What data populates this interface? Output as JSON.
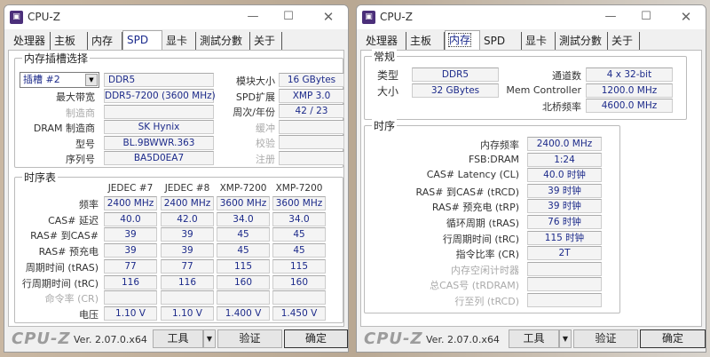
{
  "left": {
    "title": "CPU-Z",
    "tabs": [
      "处理器",
      "主板",
      "内存",
      "SPD",
      "显卡",
      "測試分數",
      "关于"
    ],
    "slot_group": "内存插槽选择",
    "slot_select": "插槽 #2",
    "type_value": "DDR5",
    "left_fields": [
      {
        "label": "最大带宽",
        "value": "DDR5-7200 (3600 MHz)",
        "dim": false
      },
      {
        "label": "制造商",
        "value": "",
        "dim": true
      },
      {
        "label": "DRAM 制造商",
        "value": "SK Hynix",
        "dim": false
      },
      {
        "label": "型号",
        "value": "BL.9BWWR.363",
        "dim": false
      },
      {
        "label": "序列号",
        "value": "BA5D0EA7",
        "dim": false
      }
    ],
    "right_fields": [
      {
        "label": "模块大小",
        "value": "16 GBytes",
        "dim": false
      },
      {
        "label": "SPD扩展",
        "value": "XMP 3.0",
        "dim": false
      },
      {
        "label": "周次/年份",
        "value": "42 / 23",
        "dim": false
      },
      {
        "label": "缓冲",
        "value": "",
        "dim": true
      },
      {
        "label": "校验",
        "value": "",
        "dim": true
      },
      {
        "label": "注册",
        "value": "",
        "dim": true
      }
    ],
    "timing_group": "时序表",
    "timing_columns": [
      "JEDEC #7",
      "JEDEC #8",
      "XMP-7200",
      "XMP-7200"
    ],
    "timing_rows": [
      {
        "label": "频率",
        "values": [
          "2400 MHz",
          "2400 MHz",
          "3600 MHz",
          "3600 MHz"
        ],
        "dim": false
      },
      {
        "label": "CAS# 延迟",
        "values": [
          "40.0",
          "42.0",
          "34.0",
          "34.0"
        ],
        "dim": false
      },
      {
        "label": "RAS# 到CAS#",
        "values": [
          "39",
          "39",
          "45",
          "45"
        ],
        "dim": false
      },
      {
        "label": "RAS# 预充电",
        "values": [
          "39",
          "39",
          "45",
          "45"
        ],
        "dim": false
      },
      {
        "label": "周期时间 (tRAS)",
        "values": [
          "77",
          "77",
          "115",
          "115"
        ],
        "dim": false
      },
      {
        "label": "行周期时间 (tRC)",
        "values": [
          "116",
          "116",
          "160",
          "160"
        ],
        "dim": false
      },
      {
        "label": "命令率 (CR)",
        "values": [
          "",
          "",
          "",
          ""
        ],
        "dim": true
      },
      {
        "label": "电压",
        "values": [
          "1.10 V",
          "1.10 V",
          "1.400 V",
          "1.450 V"
        ],
        "dim": false
      }
    ],
    "footer": {
      "logo": "CPU-Z",
      "version": "Ver. 2.07.0.x64",
      "tools": "工具",
      "validate": "验证",
      "ok": "确定"
    }
  },
  "right": {
    "title": "CPU-Z",
    "tabs": [
      "处理器",
      "主板",
      "内存",
      "SPD",
      "显卡",
      "測試分數",
      "关于"
    ],
    "general_group": "常规",
    "general_left": [
      {
        "label": "类型",
        "value": "DDR5"
      },
      {
        "label": "大小",
        "value": "32 GBytes"
      }
    ],
    "general_right": [
      {
        "label": "通道数",
        "value": "4 x 32-bit"
      },
      {
        "label": "Mem Controller",
        "value": "1200.0 MHz"
      },
      {
        "label": "北桥频率",
        "value": "4600.0 MHz"
      }
    ],
    "timing_group": "时序",
    "timings": [
      {
        "label": "内存频率",
        "value": "2400.0 MHz",
        "dim": false
      },
      {
        "label": "FSB:DRAM",
        "value": "1:24",
        "dim": false
      },
      {
        "label": "CAS# Latency (CL)",
        "value": "40.0 时钟",
        "dim": false
      },
      {
        "label": "RAS# 到CAS# (tRCD)",
        "value": "39 时钟",
        "dim": false
      },
      {
        "label": "RAS# 预充电 (tRP)",
        "value": "39 时钟",
        "dim": false
      },
      {
        "label": "循环周期 (tRAS)",
        "value": "76 时钟",
        "dim": false
      },
      {
        "label": "行周期时间 (tRC)",
        "value": "115 时钟",
        "dim": false
      },
      {
        "label": "指令比率 (CR)",
        "value": "2T",
        "dim": false
      },
      {
        "label": "内存空闲计时器",
        "value": "",
        "dim": true
      },
      {
        "label": "总CAS号 (tRDRAM)",
        "value": "",
        "dim": true
      },
      {
        "label": "行至列 (tRCD)",
        "value": "",
        "dim": true
      }
    ],
    "footer": {
      "logo": "CPU-Z",
      "version": "Ver. 2.07.0.x64",
      "tools": "工具",
      "validate": "验证",
      "ok": "确定"
    }
  }
}
